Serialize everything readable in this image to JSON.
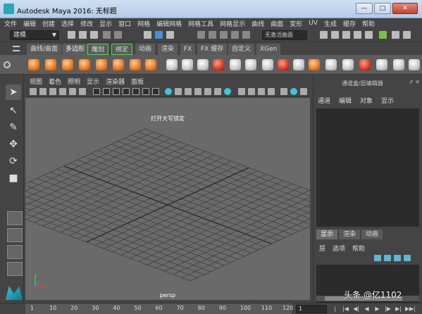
{
  "window": {
    "title": "Autodesk Maya 2016: 无标题",
    "buttons": {
      "minimize": "—",
      "maximize": "□",
      "close": "✕"
    }
  },
  "menubar": {
    "items": [
      "文件",
      "编辑",
      "创建",
      "选择",
      "修改",
      "显示",
      "窗口",
      "网格",
      "编辑网格",
      "网格工具",
      "网格显示",
      "曲线",
      "曲面",
      "变形",
      "UV",
      "生成",
      "缓存",
      "帮助"
    ]
  },
  "statusline": {
    "menuset": "建模",
    "name_field": "无激活曲面"
  },
  "shelf": {
    "tabs": [
      "曲线/曲面",
      "多边形",
      "雕刻",
      "绑定",
      "动画",
      "渲染",
      "FX",
      "FX 缓存",
      "自定义",
      "XGen"
    ],
    "active_tab": "多边形",
    "icon_names": [
      "sphere-icon",
      "cube-icon",
      "cylinder-icon",
      "cone-icon",
      "plane-icon",
      "torus-icon",
      "pipe-icon",
      "helix-icon",
      "combine-icon",
      "separate-icon",
      "extract-icon",
      "smooth-icon",
      "boolean-icon",
      "reduce-icon",
      "mirror-icon",
      "bevel-icon",
      "bridge-icon",
      "extrude-icon",
      "merge-icon",
      "planar-uv-icon",
      "auto-uv-icon",
      "uv-editor-icon",
      "multicut-icon",
      "quad-draw-icon",
      "target-weld-icon"
    ]
  },
  "panel": {
    "menus": [
      "视图",
      "着色",
      "照明",
      "显示",
      "渲染器",
      "面板"
    ],
    "viewport_label": "打开大写锁定",
    "camera": "persp"
  },
  "channelbox": {
    "title": "通道盒/层编辑器",
    "menus": [
      "通道",
      "编辑",
      "对象",
      "显示"
    ]
  },
  "layers": {
    "tabs": [
      "显示",
      "渲染",
      "动画"
    ],
    "active_tab": "显示",
    "menus": [
      "层",
      "选项",
      "帮助"
    ]
  },
  "timeline": {
    "ticks": [
      "1",
      "10",
      "20",
      "30",
      "40",
      "50",
      "60",
      "70",
      "80",
      "90",
      "100",
      "110",
      "120"
    ],
    "current_frame": "1",
    "buttons": [
      "|◀◀",
      "|◀",
      "◀|",
      "◀",
      "▶",
      "|▶",
      "▶|",
      "▶▶|"
    ]
  },
  "watermark": "头条 @亿1102"
}
